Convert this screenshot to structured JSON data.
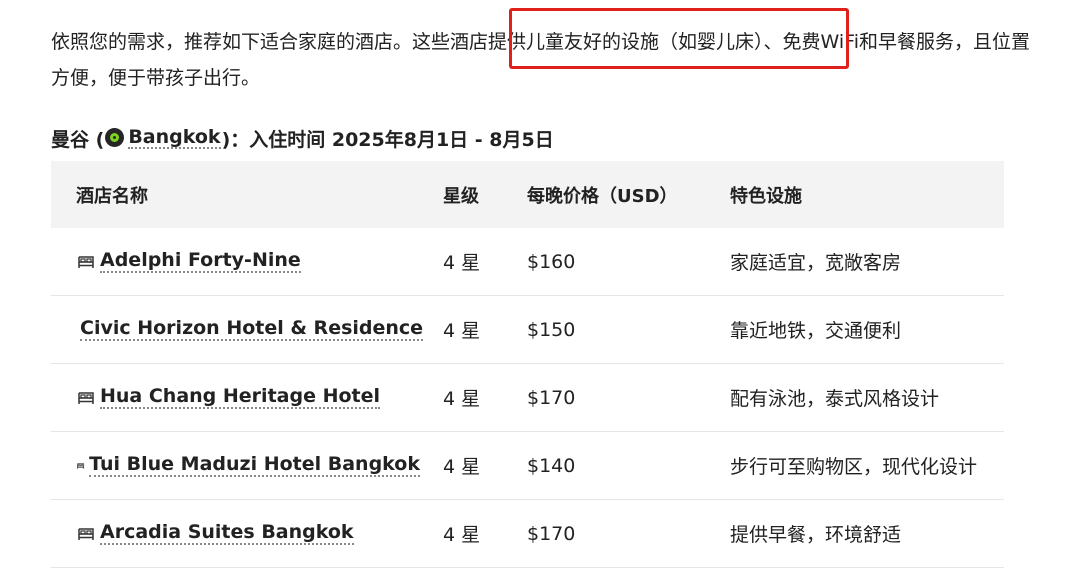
{
  "intro": {
    "text": "依照您的需求，推荐如下适合家庭的酒店。这些酒店提供儿童友好的设施（如婴儿床）、免费WiFi和早餐服务，且位置方便，便于带孩子出行。"
  },
  "heading": {
    "prefix": "曼谷 (",
    "location": "Bangkok",
    "suffix": " )：入住时间 2025年8月1日 - 8月5日",
    "location_icon": "location-pin-icon"
  },
  "table": {
    "headers": [
      "酒店名称",
      "星级",
      "每晚价格（USD）",
      "特色设施"
    ],
    "rows": [
      {
        "name": "Adelphi Forty-Nine",
        "stars": "4 星",
        "price": "$160",
        "features": "家庭适宜，宽敞客房"
      },
      {
        "name": "Civic Horizon Hotel & Residence",
        "stars": "4 星",
        "price": "$150",
        "features": "靠近地铁，交通便利"
      },
      {
        "name": "Hua Chang Heritage Hotel",
        "stars": "4 星",
        "price": "$170",
        "features": "配有泳池，泰式风格设计"
      },
      {
        "name": "Tui Blue Maduzi Hotel Bangkok",
        "stars": "4 星",
        "price": "$140",
        "features": "步行可至购物区，现代化设计"
      },
      {
        "name": "Arcadia Suites Bangkok",
        "stars": "4 星",
        "price": "$170",
        "features": "提供早餐，环境舒适"
      }
    ],
    "row_icon": "bed-icon"
  },
  "colors": {
    "highlight_border": "#e0201b",
    "header_bg": "#f3f3f3",
    "pin_green": "#7ed321"
  }
}
